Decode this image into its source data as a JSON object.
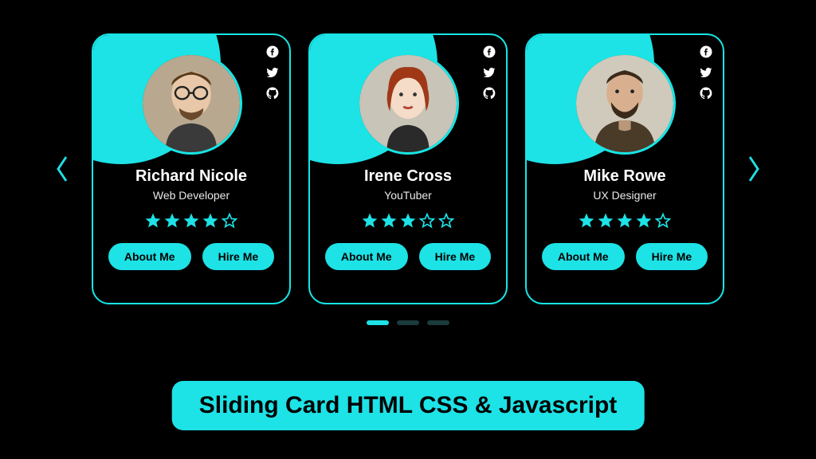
{
  "banner": {
    "title": "Sliding Card HTML CSS & Javascript"
  },
  "accent_color": "#1de2e6",
  "pagination": {
    "active": 0,
    "count": 3
  },
  "buttons": {
    "about": "About Me",
    "hire": "Hire Me"
  },
  "socials": [
    "facebook",
    "twitter",
    "github"
  ],
  "cards": [
    {
      "name": "Richard Nicole",
      "role": "Web Developer",
      "rating": 4,
      "avatar_variant": "glasses"
    },
    {
      "name": "Irene Cross",
      "role": "YouTuber",
      "rating": 3,
      "avatar_variant": "redhair"
    },
    {
      "name": "Mike Rowe",
      "role": "UX Designer",
      "rating": 4,
      "avatar_variant": "beard"
    }
  ]
}
